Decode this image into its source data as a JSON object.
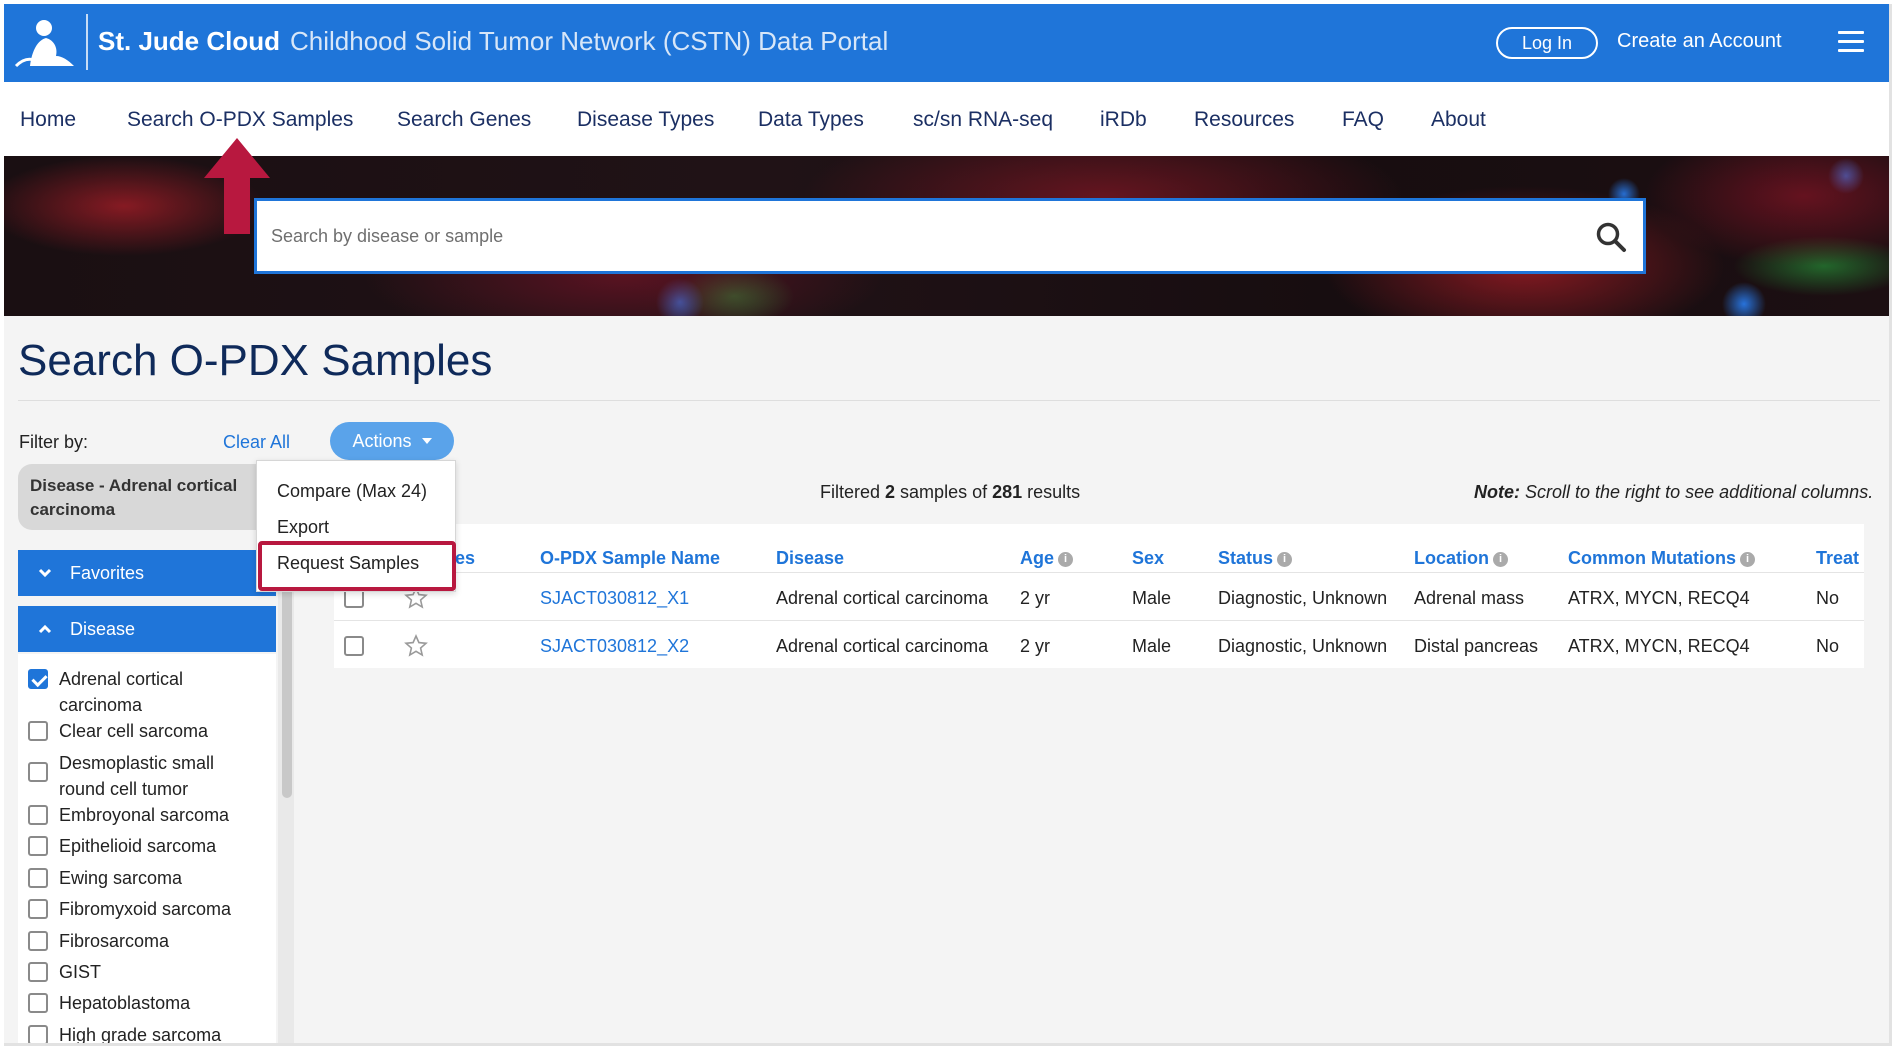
{
  "header": {
    "brand": "St. Jude Cloud",
    "portal_title": "Childhood Solid Tumor Network (CSTN) Data Portal",
    "login_label": "Log In",
    "create_account_label": "Create an Account",
    "primary_color": "#1f75d9"
  },
  "nav": {
    "items": [
      "Home",
      "Search O-PDX Samples",
      "Search Genes",
      "Disease Types",
      "Data Types",
      "sc/sn RNA-seq",
      "iRDb",
      "Resources",
      "FAQ",
      "About"
    ]
  },
  "search": {
    "placeholder": "Search by disease or sample",
    "value": ""
  },
  "page": {
    "title": "Search O-PDX Samples"
  },
  "filters": {
    "filter_by_label": "Filter by:",
    "clear_all_label": "Clear All",
    "actions_label": "Actions",
    "active_chip": "Disease - Adrenal cortical carcinoma",
    "favorites_label": "Favorites",
    "disease_label": "Disease",
    "disease_options": [
      {
        "label": "Adrenal cortical carcinoma",
        "checked": true
      },
      {
        "label": "Clear cell sarcoma",
        "checked": false
      },
      {
        "label": "Desmoplastic small round cell tumor",
        "checked": false
      },
      {
        "label": "Embroyonal sarcoma",
        "checked": false
      },
      {
        "label": "Epithelioid sarcoma",
        "checked": false
      },
      {
        "label": "Ewing sarcoma",
        "checked": false
      },
      {
        "label": "Fibromyxoid sarcoma",
        "checked": false
      },
      {
        "label": "Fibrosarcoma",
        "checked": false
      },
      {
        "label": "GIST",
        "checked": false
      },
      {
        "label": "Hepatoblastoma",
        "checked": false
      },
      {
        "label": "High grade sarcoma",
        "checked": false
      }
    ]
  },
  "actions_menu": {
    "items": [
      "Compare (Max 24)",
      "Export",
      "Request Samples"
    ],
    "highlighted": "Request Samples",
    "highlight_color": "#b8183f"
  },
  "results": {
    "filtered_prefix": "Filtered ",
    "filtered_count": "2",
    "filtered_middle": " samples of ",
    "total_count": "281",
    "filtered_suffix": " results",
    "note_label": "Note:",
    "note_text": " Scroll to the right to see additional columns.",
    "columns": [
      "ites",
      "O-PDX Sample Name",
      "Disease",
      "Age",
      "Sex",
      "Status",
      "Location",
      "Common Mutations",
      "Treat"
    ],
    "rows": [
      {
        "sample": "SJACT030812_X1",
        "disease": "Adrenal cortical carcinoma",
        "age": "2 yr",
        "sex": "Male",
        "status": "Diagnostic, Unknown",
        "location": "Adrenal mass",
        "mutations": "ATRX, MYCN, RECQ4",
        "treat": "No"
      },
      {
        "sample": "SJACT030812_X2",
        "disease": "Adrenal cortical carcinoma",
        "age": "2 yr",
        "sex": "Male",
        "status": "Diagnostic, Unknown",
        "location": "Distal pancreas",
        "mutations": "ATRX, MYCN, RECQ4",
        "treat": "No"
      }
    ]
  },
  "icons": {
    "logo": "st-jude-logo-icon",
    "menu": "hamburger-menu-icon",
    "search": "search-icon",
    "arrow": "red-up-arrow-icon",
    "info": "info-icon",
    "favorite": "star-icon",
    "chevron_down": "chevron-down-icon",
    "chevron_up": "chevron-up-icon",
    "info_glyph": "i"
  }
}
